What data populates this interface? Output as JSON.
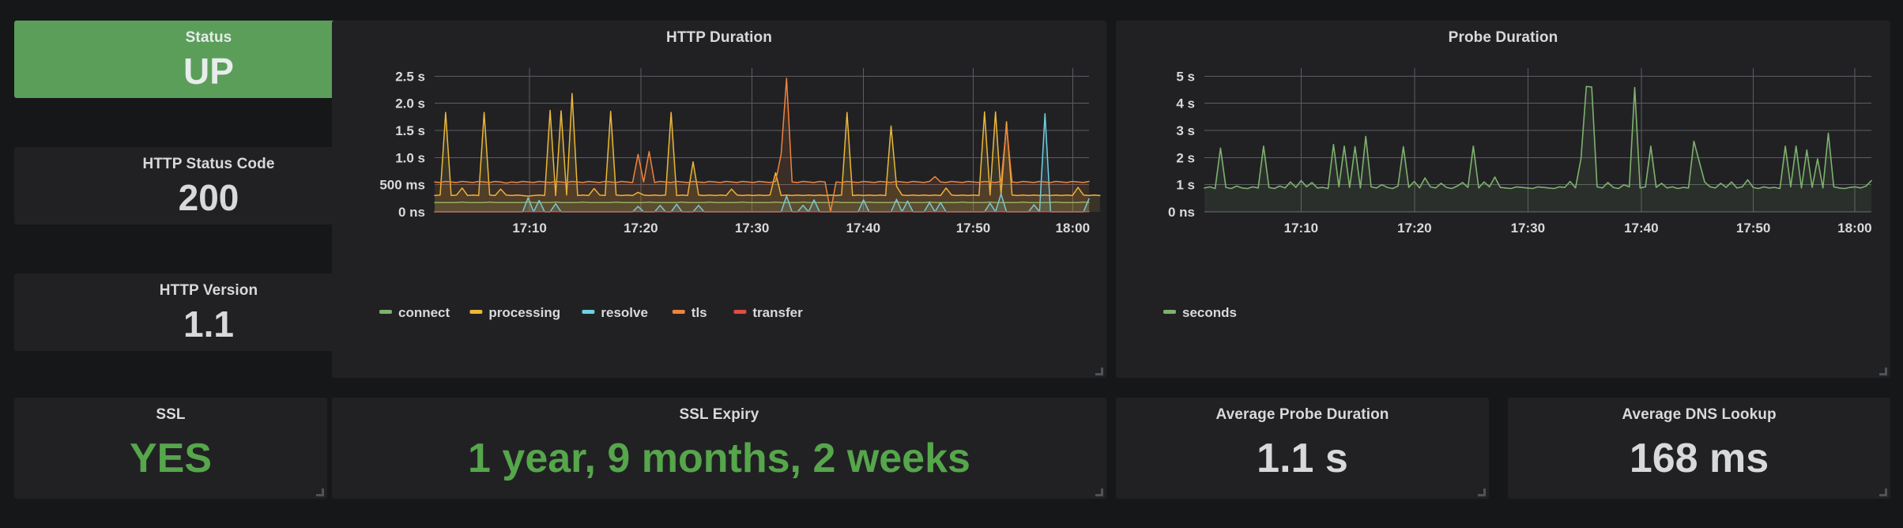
{
  "theme": {
    "page_bg": "#161719",
    "panel_bg": "#212124",
    "status_green": "#5a9e5a",
    "text_green": "#56a64b",
    "text_primary": "#d8d9da",
    "grid_line": "#5a5d62"
  },
  "panels": {
    "status": {
      "title": "Status",
      "value": "UP"
    },
    "http_status_code": {
      "title": "HTTP Status Code",
      "value": "200"
    },
    "http_version": {
      "title": "HTTP Version",
      "value": "1.1"
    },
    "ssl": {
      "title": "SSL",
      "value": "YES"
    },
    "ssl_expiry": {
      "title": "SSL Expiry",
      "value": "1 year, 9 months, 2 weeks"
    },
    "average_probe_duration": {
      "title": "Average Probe Duration",
      "value": "1.1 s"
    },
    "average_dns_lookup": {
      "title": "Average DNS Lookup",
      "value": "168 ms"
    }
  },
  "chart_data": [
    {
      "id": "http_duration",
      "type": "line",
      "title": "HTTP Duration",
      "xlabel": "",
      "ylabel": "",
      "grid": true,
      "legend_position": "bottom",
      "xtick_labels": [
        "17:10",
        "17:20",
        "17:30",
        "17:40",
        "17:50",
        "18:00"
      ],
      "ytick_labels": [
        "0 ns",
        "500 ms",
        "1.0 s",
        "1.5 s",
        "2.0 s",
        "2.5 s"
      ],
      "ytick_values": [
        0,
        0.5,
        1.0,
        1.5,
        2.0,
        2.5
      ],
      "ylim": [
        0,
        2.65
      ],
      "xlim": [
        "17:03",
        "18:02"
      ],
      "series": [
        {
          "name": "connect",
          "color": "#7eb26d",
          "values": [
            0.17,
            0.17,
            0.17,
            0.17,
            0.17,
            0.18,
            0.17,
            0.17,
            0.17,
            0.17,
            0.18,
            0.17,
            0.17,
            0.17,
            0.17,
            0.17,
            0.17,
            0.18,
            0.17,
            0.17,
            0.17,
            0.17,
            0.18,
            0.17,
            0.17,
            0.17,
            0.17,
            0.18,
            0.17,
            0.17,
            0.17,
            0.17,
            0.17,
            0.18,
            0.17,
            0.17,
            0.17,
            0.17,
            0.17,
            0.18,
            0.17,
            0.17,
            0.17,
            0.17,
            0.17,
            0.18,
            0.17,
            0.17,
            0.17,
            0.17,
            0.18,
            0.17,
            0.17,
            0.17,
            0.17,
            0.17,
            0.18,
            0.17,
            0.17,
            0.17,
            0.17,
            0.17,
            0.18,
            0.17,
            0.17,
            0.17,
            0.17,
            0.18,
            0.17,
            0.17,
            0.17,
            0.17,
            0.17,
            0.18,
            0.17,
            0.17,
            0.17,
            0.17,
            0.17,
            0.18,
            0.17,
            0.17,
            0.17,
            0.17,
            0.18,
            0.17,
            0.17,
            0.17,
            0.17,
            0.17,
            0.18,
            0.17,
            0.17,
            0.17,
            0.17,
            0.17,
            0.18,
            0.17,
            0.17,
            0.17,
            0.17,
            0.18,
            0.17,
            0.17,
            0.17,
            0.17,
            0.17,
            0.18,
            0.17,
            0.17,
            0.17,
            0.17,
            0.17,
            0.18,
            0.17,
            0.17,
            0.17,
            0.17,
            0.18,
            0.17
          ]
        },
        {
          "name": "processing",
          "color": "#eab839",
          "values": [
            0.3,
            0.31,
            1.83,
            0.3,
            0.31,
            0.44,
            0.3,
            0.31,
            0.3,
            1.83,
            0.31,
            0.3,
            0.42,
            0.31,
            0.3,
            0.31,
            0.3,
            0.29,
            0.3,
            0.31,
            0.3,
            1.87,
            0.3,
            1.86,
            0.31,
            2.18,
            0.3,
            0.31,
            0.3,
            0.43,
            0.31,
            0.3,
            1.85,
            0.31,
            0.3,
            0.31,
            0.3,
            0.36,
            0.31,
            0.3,
            0.31,
            0.3,
            0.31,
            1.83,
            0.3,
            0.31,
            0.3,
            0.92,
            0.31,
            0.3,
            0.31,
            0.3,
            0.31,
            0.3,
            0.42,
            0.31,
            0.3,
            0.31,
            0.3,
            0.31,
            0.3,
            0.31,
            0.72,
            0.3,
            0.31,
            0.3,
            0.31,
            0.3,
            0.31,
            0.3,
            0.31,
            0.3,
            0.31,
            0.3,
            0.31,
            1.83,
            0.3,
            0.31,
            0.3,
            0.31,
            0.3,
            0.31,
            0.3,
            1.58,
            0.47,
            0.31,
            0.3,
            0.31,
            0.3,
            0.31,
            0.3,
            0.31,
            0.3,
            0.44,
            0.31,
            0.3,
            0.31,
            0.3,
            0.31,
            0.3,
            1.84,
            0.31,
            1.84,
            0.31,
            1.66,
            0.31,
            0.3,
            0.31,
            0.3,
            0.31,
            0.3,
            0.31,
            0.3,
            0.31,
            0.3,
            0.31,
            0.3,
            0.45,
            0.31,
            0.3,
            0.31,
            0.3
          ]
        },
        {
          "name": "resolve",
          "color": "#6ed0e0",
          "values": [
            0.0,
            0.0,
            0.0,
            0.0,
            0.0,
            0.0,
            0.0,
            0.0,
            0.0,
            0.0,
            0.0,
            0.0,
            0.0,
            0.0,
            0.0,
            0.0,
            0.0,
            0.26,
            0.0,
            0.21,
            0.0,
            0.0,
            0.15,
            0.0,
            0.0,
            0.0,
            0.0,
            0.0,
            0.0,
            0.0,
            0.0,
            0.0,
            0.0,
            0.0,
            0.0,
            0.0,
            0.0,
            0.1,
            0.0,
            0.0,
            0.0,
            0.12,
            0.0,
            0.0,
            0.14,
            0.0,
            0.0,
            0.0,
            0.12,
            0.0,
            0.0,
            0.0,
            0.0,
            0.0,
            0.0,
            0.0,
            0.0,
            0.0,
            0.0,
            0.0,
            0.0,
            0.0,
            0.0,
            0.0,
            0.29,
            0.0,
            0.0,
            0.12,
            0.0,
            0.22,
            0.0,
            0.0,
            0.0,
            0.0,
            0.0,
            0.0,
            0.0,
            0.0,
            0.22,
            0.0,
            0.0,
            0.0,
            0.0,
            0.0,
            0.23,
            0.0,
            0.2,
            0.0,
            0.0,
            0.0,
            0.17,
            0.0,
            0.17,
            0.0,
            0.0,
            0.0,
            0.0,
            0.0,
            0.0,
            0.0,
            0.0,
            0.16,
            0.0,
            0.33,
            0.0,
            0.0,
            0.0,
            0.0,
            0.0,
            0.13,
            0.0,
            1.81,
            0.0,
            0.0,
            0.0,
            0.0,
            0.0,
            0.0,
            0.0,
            0.24
          ]
        },
        {
          "name": "tls",
          "color": "#ef843c",
          "values": [
            0.55,
            0.54,
            0.56,
            0.55,
            0.54,
            0.56,
            0.55,
            0.54,
            0.56,
            0.55,
            0.54,
            0.56,
            0.55,
            0.53,
            0.55,
            0.54,
            0.56,
            0.55,
            0.54,
            0.56,
            0.55,
            0.54,
            0.56,
            0.55,
            0.54,
            0.56,
            0.55,
            0.54,
            0.56,
            0.55,
            0.54,
            0.56,
            0.55,
            0.54,
            0.56,
            0.55,
            0.54,
            1.06,
            0.55,
            1.11,
            0.54,
            0.56,
            0.55,
            0.54,
            0.56,
            0.55,
            0.54,
            0.56,
            0.55,
            0.54,
            0.56,
            0.55,
            0.54,
            0.56,
            0.55,
            0.54,
            0.56,
            0.55,
            0.54,
            0.56,
            0.55,
            0.54,
            0.56,
            1.06,
            2.46,
            0.55,
            0.54,
            0.56,
            0.55,
            0.54,
            0.56,
            0.55,
            0.0,
            0.55,
            0.54,
            0.56,
            0.55,
            0.54,
            0.56,
            0.55,
            0.54,
            0.56,
            0.55,
            0.54,
            0.56,
            0.55,
            0.54,
            0.56,
            0.55,
            0.54,
            0.56,
            0.65,
            0.55,
            0.54,
            0.56,
            0.55,
            0.54,
            0.56,
            0.55,
            0.54,
            0.56,
            0.55,
            0.54,
            0.56,
            1.58,
            0.55,
            0.54,
            0.56,
            0.55,
            0.54,
            0.56,
            0.55,
            0.54,
            0.56,
            0.55,
            0.54,
            0.56,
            0.55,
            0.54,
            0.56
          ]
        },
        {
          "name": "transfer",
          "color": "#e24d42",
          "values": [
            0.004,
            0.004,
            0.004,
            0.004,
            0.004,
            0.004,
            0.004,
            0.004,
            0.004,
            0.004,
            0.004,
            0.004,
            0.004,
            0.004,
            0.004,
            0.004,
            0.004,
            0.004,
            0.004,
            0.004,
            0.004,
            0.004,
            0.004,
            0.004,
            0.004,
            0.004,
            0.004,
            0.004,
            0.004,
            0.004,
            0.004,
            0.004,
            0.004,
            0.004,
            0.004,
            0.004,
            0.004,
            0.004,
            0.004,
            0.004,
            0.004,
            0.004,
            0.004,
            0.004,
            0.004,
            0.004,
            0.004,
            0.004,
            0.004,
            0.004,
            0.004,
            0.004,
            0.004,
            0.004,
            0.004,
            0.004,
            0.004,
            0.004,
            0.004,
            0.004,
            0.004,
            0.004,
            0.004,
            0.004,
            0.004,
            0.004,
            0.004,
            0.004,
            0.004,
            0.004,
            0.004,
            0.004,
            0.004,
            0.004,
            0.004,
            0.004,
            0.004,
            0.004,
            0.004,
            0.004,
            0.004,
            0.004,
            0.004,
            0.004,
            0.004,
            0.004,
            0.004,
            0.004,
            0.004,
            0.004,
            0.004,
            0.004,
            0.004,
            0.004,
            0.004,
            0.004,
            0.004,
            0.004,
            0.004,
            0.004,
            0.004,
            0.004,
            0.004,
            0.004,
            0.004,
            0.004,
            0.004,
            0.004,
            0.004,
            0.004,
            0.004,
            0.004,
            0.004,
            0.004,
            0.004,
            0.004,
            0.004,
            0.004,
            0.004,
            0.004
          ]
        }
      ]
    },
    {
      "id": "probe_duration",
      "type": "area",
      "title": "Probe Duration",
      "xlabel": "",
      "ylabel": "",
      "grid": true,
      "legend_position": "bottom",
      "xtick_labels": [
        "17:10",
        "17:20",
        "17:30",
        "17:40",
        "17:50",
        "18:00"
      ],
      "ytick_labels": [
        "0 ns",
        "1 s",
        "2 s",
        "3 s",
        "4 s",
        "5 s"
      ],
      "ytick_values": [
        0,
        1,
        2,
        3,
        4,
        5
      ],
      "ylim": [
        0,
        5.3
      ],
      "xlim": [
        "17:03",
        "18:02"
      ],
      "series": [
        {
          "name": "seconds",
          "color": "#7eb26d",
          "values": [
            0.88,
            0.92,
            0.86,
            2.35,
            0.9,
            0.86,
            0.95,
            0.88,
            0.86,
            0.92,
            0.88,
            2.42,
            0.9,
            0.86,
            0.95,
            0.88,
            1.1,
            0.9,
            1.15,
            0.92,
            1.08,
            0.88,
            0.9,
            0.86,
            2.48,
            0.92,
            2.42,
            0.9,
            2.4,
            0.88,
            2.78,
            0.92,
            0.88,
            1.0,
            0.9,
            0.86,
            0.95,
            2.4,
            0.9,
            1.12,
            0.88,
            1.25,
            0.92,
            0.88,
            1.05,
            0.9,
            0.86,
            0.95,
            1.08,
            0.9,
            2.42,
            0.88,
            1.1,
            0.92,
            1.28,
            0.9,
            0.88,
            0.86,
            0.92,
            0.9,
            0.88,
            0.86,
            0.92,
            0.9,
            0.88,
            0.86,
            0.92,
            0.9,
            1.12,
            0.88,
            1.95,
            4.62,
            4.6,
            0.92,
            0.88,
            1.08,
            0.9,
            0.86,
            1.0,
            0.92,
            4.58,
            0.88,
            0.92,
            2.42,
            0.9,
            1.05,
            0.88,
            0.92,
            0.86,
            0.9,
            0.88,
            2.6,
            1.85,
            1.1,
            0.92,
            0.88,
            1.05,
            0.9,
            1.1,
            0.88,
            0.92,
            1.18,
            0.9,
            0.86,
            0.92,
            0.88,
            0.9,
            0.86,
            2.42,
            0.92,
            2.42,
            0.88,
            2.28,
            0.9,
            1.95,
            0.88,
            2.9,
            0.92,
            0.88,
            0.86,
            0.9,
            0.92,
            0.88,
            0.95,
            1.15
          ]
        }
      ]
    }
  ]
}
